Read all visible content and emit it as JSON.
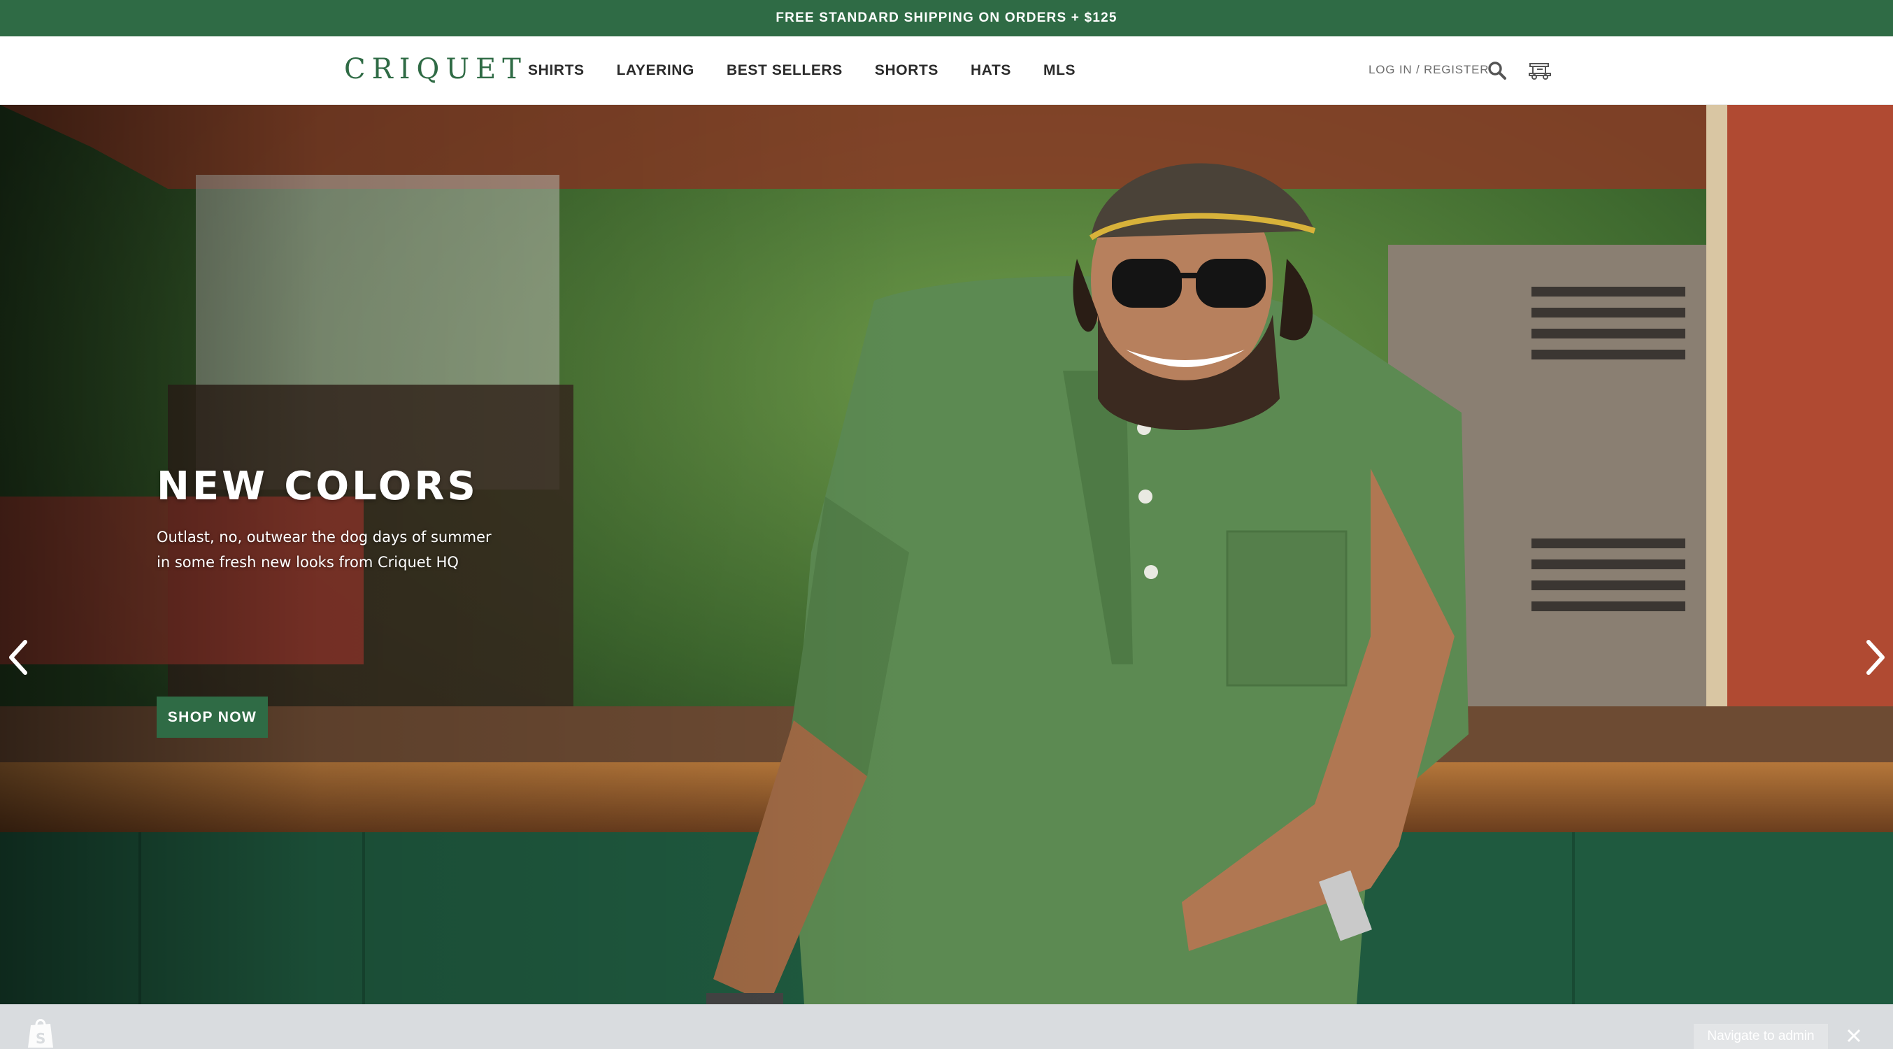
{
  "announcement": {
    "text": "FREE STANDARD SHIPPING ON ORDERS + $125"
  },
  "header": {
    "logo": "CRIQUET",
    "nav": [
      "SHIRTS",
      "LAYERING",
      "BEST SELLERS",
      "SHORTS",
      "HATS",
      "MLS"
    ],
    "account_link": "LOG IN / REGISTER",
    "icons": {
      "search": "search-icon",
      "cart": "golf-cart-icon"
    }
  },
  "hero": {
    "title": "NEW COLORS",
    "subtitle_line1": "Outlast, no, outwear the dog days of summer",
    "subtitle_line2": "in some fresh new looks from Criquet HQ",
    "cta": "SHOP NOW",
    "slides_total": 2,
    "active_slide": 2,
    "icons": {
      "prev": "chevron-left-icon",
      "next": "chevron-right-icon",
      "chat": "chat-bubble-icon"
    }
  },
  "admin_bar": {
    "navigate_label": "Navigate to admin",
    "icons": {
      "logo": "shopify-bag-icon",
      "close": "close-icon"
    }
  },
  "colors": {
    "brand_green": "#2f6b45",
    "header_bg": "#ffffff",
    "admin_bar_bg": "#d9dcdf"
  }
}
